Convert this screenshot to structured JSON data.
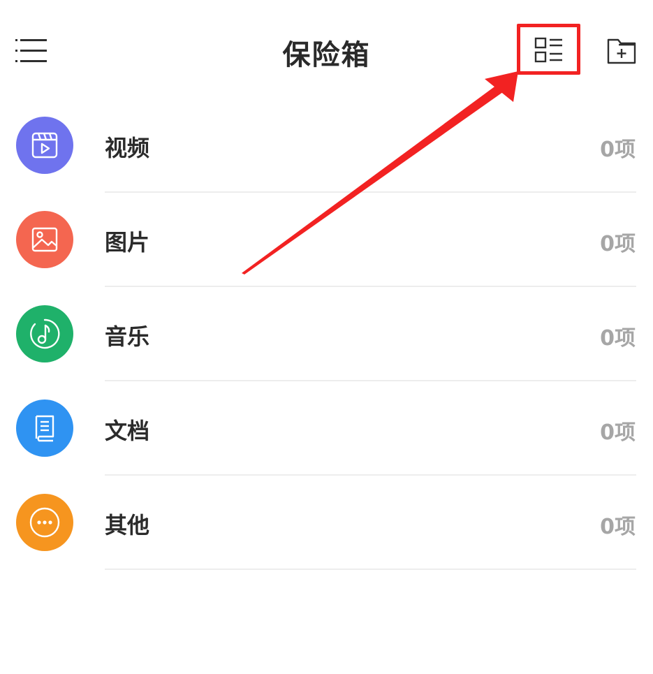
{
  "header": {
    "title": "保险箱",
    "menu_icon": "hamburger-menu-icon",
    "view_toggle_icon": "list-view-icon",
    "new_folder_icon": "new-folder-icon"
  },
  "categories": [
    {
      "label": "视频",
      "count": "0项",
      "icon": "video-clapper-icon",
      "color": "#6f73ee"
    },
    {
      "label": "图片",
      "count": "0项",
      "icon": "image-icon",
      "color": "#f46650"
    },
    {
      "label": "音乐",
      "count": "0项",
      "icon": "music-note-icon",
      "color": "#1fb16a"
    },
    {
      "label": "文档",
      "count": "0项",
      "icon": "document-icon",
      "color": "#2f93f2"
    },
    {
      "label": "其他",
      "count": "0项",
      "icon": "more-dots-icon",
      "color": "#f6951f"
    }
  ],
  "annotation": {
    "highlight_color": "#f22222"
  }
}
